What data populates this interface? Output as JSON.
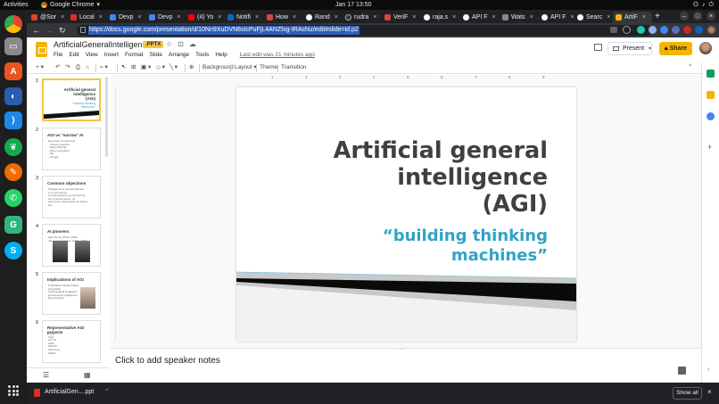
{
  "system": {
    "activities": "Activities",
    "app_name": "Google Chrome",
    "clock": "Jan 17  13:50"
  },
  "tabs": [
    {
      "label": "@Sor",
      "color": "#db4437"
    },
    {
      "label": "Local",
      "color": "#d93025"
    },
    {
      "label": "Devp",
      "color": "#4285f4"
    },
    {
      "label": "Devp",
      "color": "#4285f4"
    },
    {
      "label": "(4) Yo",
      "color": "#ff0000"
    },
    {
      "label": "Notifi",
      "color": "#0a66c2"
    },
    {
      "label": "How",
      "color": "#db4437"
    },
    {
      "label": "Rand",
      "color": "#ffffff"
    },
    {
      "label": "rudra",
      "color": "#333333"
    },
    {
      "label": "VeriF",
      "color": "#db4437"
    },
    {
      "label": "raja.s",
      "color": "#ffffff"
    },
    {
      "label": "API F",
      "color": "#ffffff"
    },
    {
      "label": "Wats",
      "color": "#888888"
    },
    {
      "label": "API F",
      "color": "#ffffff"
    },
    {
      "label": "Searc",
      "color": "#ffffff"
    },
    {
      "label": "ArtiF",
      "color": "#f4b400"
    }
  ],
  "browser": {
    "url": "https://docs.google.com/presentation/d/10Nn9XuDVN6sIcPuFjL4ANZfxg-IRAchiz/edit#slide=id.p2",
    "new_tab": "+"
  },
  "doc": {
    "title": "ArtificialGeneralIntelligence",
    "badge": ".PPTX",
    "menus": [
      "File",
      "Edit",
      "View",
      "Insert",
      "Format",
      "Slide",
      "Arrange",
      "Tools",
      "Help"
    ],
    "last_edit": "Last edit was 21 minutes ago",
    "present_label": "Present",
    "share_label": "Share"
  },
  "toolbar": {
    "background": "Background",
    "layout": "Layout",
    "theme": "Theme",
    "transition": "Transition"
  },
  "filmstrip": [
    {
      "num": "1",
      "title": "Artificial general\nintelligence\n(AGI)",
      "subtitle": "\"building thinking\nmachines\""
    },
    {
      "num": "2",
      "title": "AGI vs \"narrow\" AI",
      "bullets": "Examples of narrow AI\n  - Chess programs\n  - Spam filtering\n  - Face recognition\n  - Siri\n  - Google"
    },
    {
      "num": "3",
      "title": "Common objections",
      "bullets": "Intelligence is not well defined\nor a red herring\nConsciousness is a red herring\nNo common-sense, no\nwe'll never understand our brains\netc."
    },
    {
      "num": "4",
      "title": "AI pioneers",
      "bullets": "Alan Turing (1912–1954)\nJohn von Neumann (1903–1957)"
    },
    {
      "num": "5",
      "title": "Implications of AGI",
      "bullets": "Civilization transformation\nSingularity\nTechnological singularity\nHuman-level intelligence\nRay Kurzweil"
    },
    {
      "num": "6",
      "title": "Representative AGI projects",
      "bullets": "Cyc\nSoar\nACT-R\nLIDA\nSNePS\nOpenCog\nNARS"
    }
  ],
  "slide": {
    "title": "Artificial general\nintelligence\n(AGI)",
    "subtitle": "“building thinking\nmachines”"
  },
  "ruler_marks": [
    "1",
    "2",
    "3",
    "4",
    "5",
    "6",
    "7",
    "8",
    "9"
  ],
  "notes": {
    "placeholder": "Click to add speaker notes"
  },
  "downloads": {
    "file": "ArtificialGen....ppt",
    "show_all": "Show all"
  },
  "colors": {
    "accent_yellow": "#f6b400",
    "subtitle_blue": "#31a3c6",
    "title_gray": "#404040"
  }
}
